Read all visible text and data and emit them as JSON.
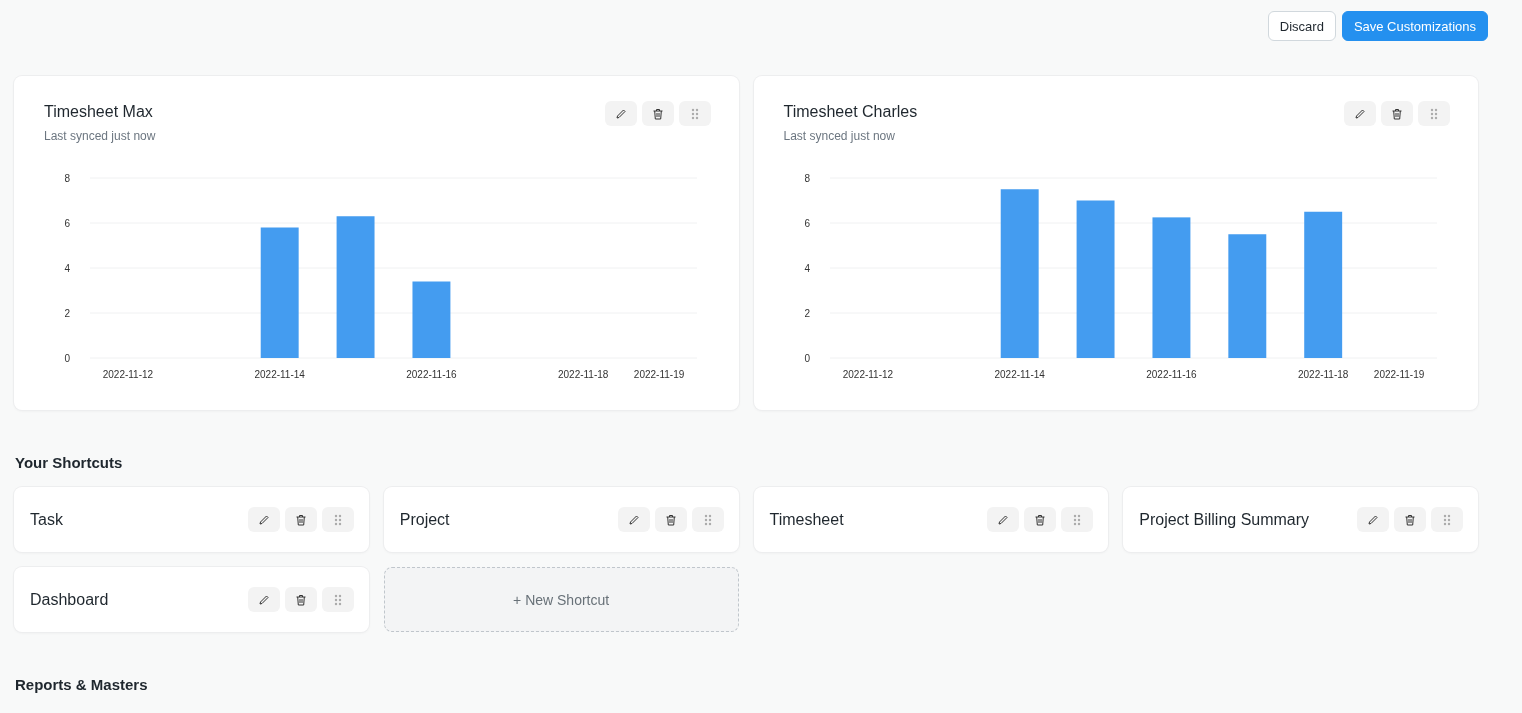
{
  "actions": [
    {
      "kind": "secondary",
      "label": "Discard"
    },
    {
      "kind": "primary",
      "label": "Save Customizations"
    }
  ],
  "charts": [
    {
      "title": "Timesheet Max",
      "subtitle": "Last synced just now",
      "chart_data": {
        "type": "bar",
        "categories": [
          "2022-11-12",
          null,
          "2022-11-14",
          null,
          "2022-11-16",
          null,
          "2022-11-18",
          "2022-11-19"
        ],
        "series": [
          {
            "color": "#449cf0",
            "values": [
              0,
              0,
              5.8,
              6.3,
              3.4,
              0,
              0,
              0
            ]
          }
        ],
        "ylim": [
          0,
          8
        ],
        "yticks": [
          0,
          2,
          4,
          6,
          8
        ],
        "grid": true
      }
    },
    {
      "title": "Timesheet Charles",
      "subtitle": "Last synced just now",
      "chart_data": {
        "type": "bar",
        "categories": [
          "2022-11-12",
          null,
          "2022-11-14",
          null,
          "2022-11-16",
          null,
          "2022-11-18",
          "2022-11-19"
        ],
        "series": [
          {
            "color": "#449cf0",
            "values": [
              0,
              0,
              7.5,
              7.0,
              6.25,
              5.5,
              6.5,
              0
            ]
          }
        ],
        "ylim": [
          0,
          8
        ],
        "yticks": [
          0,
          2,
          4,
          6,
          8
        ],
        "grid": true
      }
    }
  ],
  "shortcuts_heading": "Your Shortcuts",
  "shortcuts": [
    {
      "label": "Task"
    },
    {
      "label": "Project"
    },
    {
      "label": "Timesheet"
    },
    {
      "label": "Project Billing Summary"
    },
    {
      "label": "Dashboard"
    }
  ],
  "new_shortcut": "+ New Shortcut",
  "reports_heading": "Reports & Masters"
}
